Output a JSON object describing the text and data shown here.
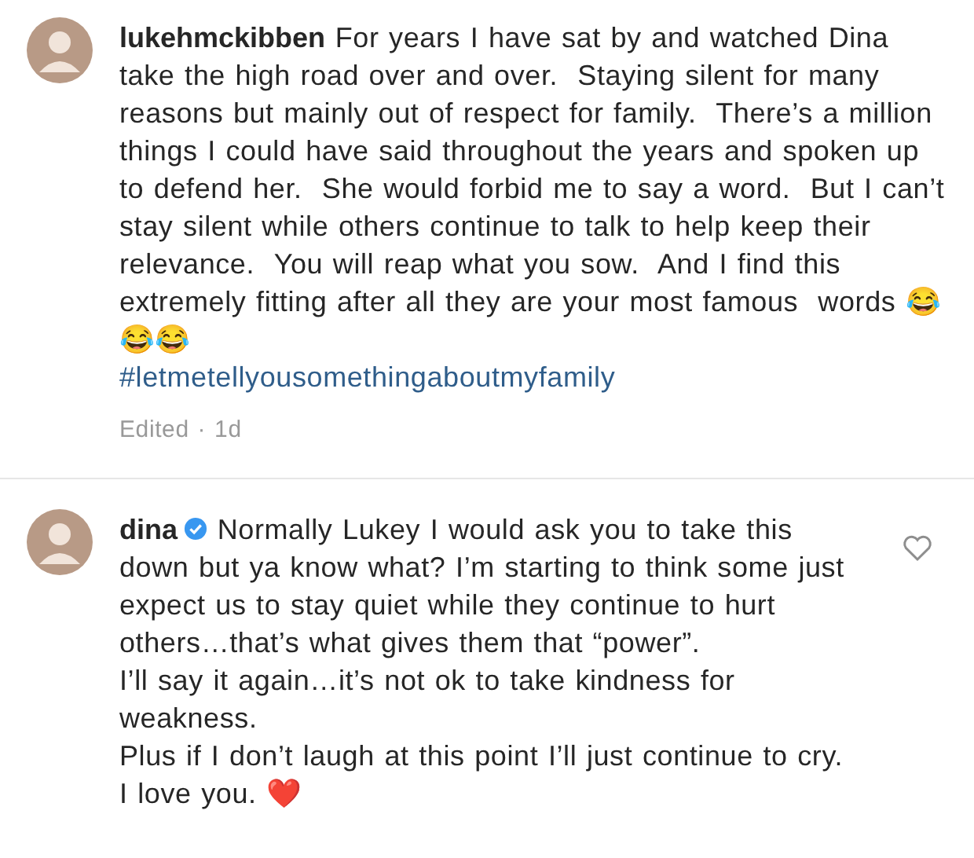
{
  "comments": [
    {
      "username": "lukehmckibben",
      "verified": false,
      "paragraphs": [
        "For years I have sat by and watched Dina take the high road over and over.  Staying silent for many reasons but mainly out of respect for family.  There’s a million things I could have said throughout the years and spoken up to defend her.  She would forbid me to say a word.  But I can’t stay silent while others continue to talk to help keep their relevance.  You will reap what you sow.  And I find this extremely fitting after all they are your most famous  words 😂😂😂"
      ],
      "hashtag": "#letmetellyousomethingaboutmyfamily",
      "meta": "Edited · 1d",
      "like_button": false
    },
    {
      "username": "dina",
      "verified": true,
      "paragraphs": [
        "Normally Lukey I would ask you to take this down but ya know what? I’m starting to think some just expect us to stay quiet while they continue to hurt others…that’s what gives them that “power”.",
        "I’ll say it again…it’s not ok to take kindness for weakness.",
        "Plus if I don’t laugh at this point I’ll just continue to cry. I love you. ❤️"
      ],
      "like_button": true
    }
  ]
}
